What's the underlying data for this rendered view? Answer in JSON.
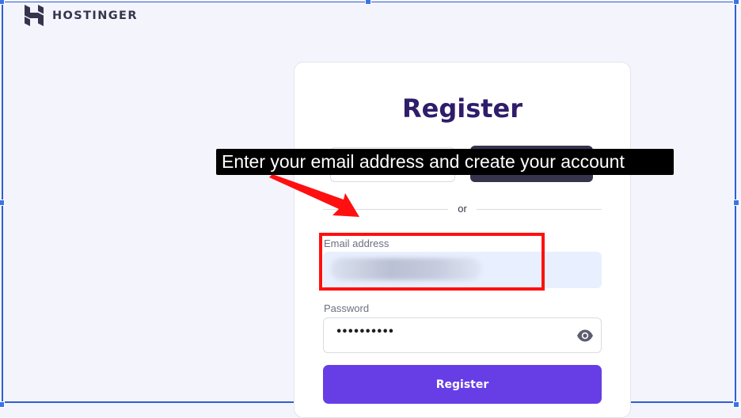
{
  "brand": {
    "name": "HOSTINGER",
    "logo_icon": "hostinger-h-logo-icon"
  },
  "form": {
    "title": "Register",
    "divider_text": "or",
    "email_label": "Email address",
    "password_label": "Password",
    "password_value": "••••••••••",
    "submit_label": "Register",
    "password_toggle_icon": "eye-icon"
  },
  "annotation": {
    "tooltip_text": "Enter your email address and create your account",
    "arrow_icon": "red-arrow-icon",
    "highlight_color": "#ff1010"
  },
  "colors": {
    "accent": "#673de6",
    "title": "#2f1c6a",
    "background": "#f4f4fd"
  }
}
